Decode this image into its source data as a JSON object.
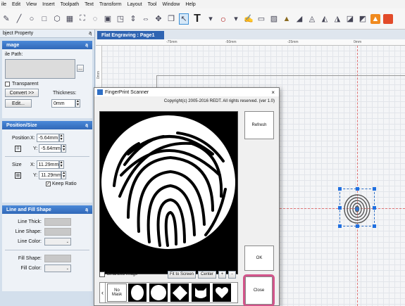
{
  "menu": [
    "ile",
    "Edit",
    "View",
    "Insert",
    "Toolpath",
    "Text",
    "Transform",
    "Layout",
    "Tool",
    "Window",
    "Help"
  ],
  "toolbar": {
    "text_tool": "T",
    "colors": {
      "orange": "#f08a1e",
      "red": "#e24b2a"
    }
  },
  "panel": {
    "title": "bject Property",
    "pin": "ą",
    "image": {
      "header": "mage",
      "file_path_label": "ile Path:",
      "browse": "...",
      "transparent_label": "Transparent",
      "convert_button": "Convert >>",
      "edit_button": "Edit...",
      "thickness_label": "Thickness:",
      "thickness_value": "0mm"
    },
    "position_size": {
      "header": "Position/Size",
      "position_label": "Position",
      "x_label": "X:",
      "x_value": "-5.64mm",
      "y_label": "Y:",
      "y_value": "-5.64mm",
      "size_label": "Size",
      "w_label": "X:",
      "w_value": "11.29mm",
      "h_label": "Y:",
      "h_value": "11.29mm",
      "keep_ratio": "Keep Ratio"
    },
    "line_fill": {
      "header": "Line and Fill Shape",
      "line_thick": "Line Thick:",
      "line_shape": "Line Shape:",
      "line_color": "Line Color:",
      "fill_shape": "Fill Shape:",
      "fill_color": "Fill Color:"
    }
  },
  "document": {
    "tab": "Flat Engraving : Page1",
    "ruler_labels": [
      "-75mm",
      "-50mm",
      "-25mm",
      "0mm"
    ],
    "vruler_label": "0mm"
  },
  "dialog": {
    "title": "FingerPrint Scanner",
    "close_x": "×",
    "copyright": "Copyright(c) 2005-2016 REDT. All rights reserved.  (ver 1.0)",
    "refresh": "Refresh",
    "ok": "OK",
    "close": "Close",
    "binarized": "Binarized Image",
    "fit_to_screen": "Fit to Screen",
    "center": "Center",
    "plus": "+",
    "minus": "-",
    "no_mask": "No\nMask",
    "scroll_left": "‹"
  }
}
